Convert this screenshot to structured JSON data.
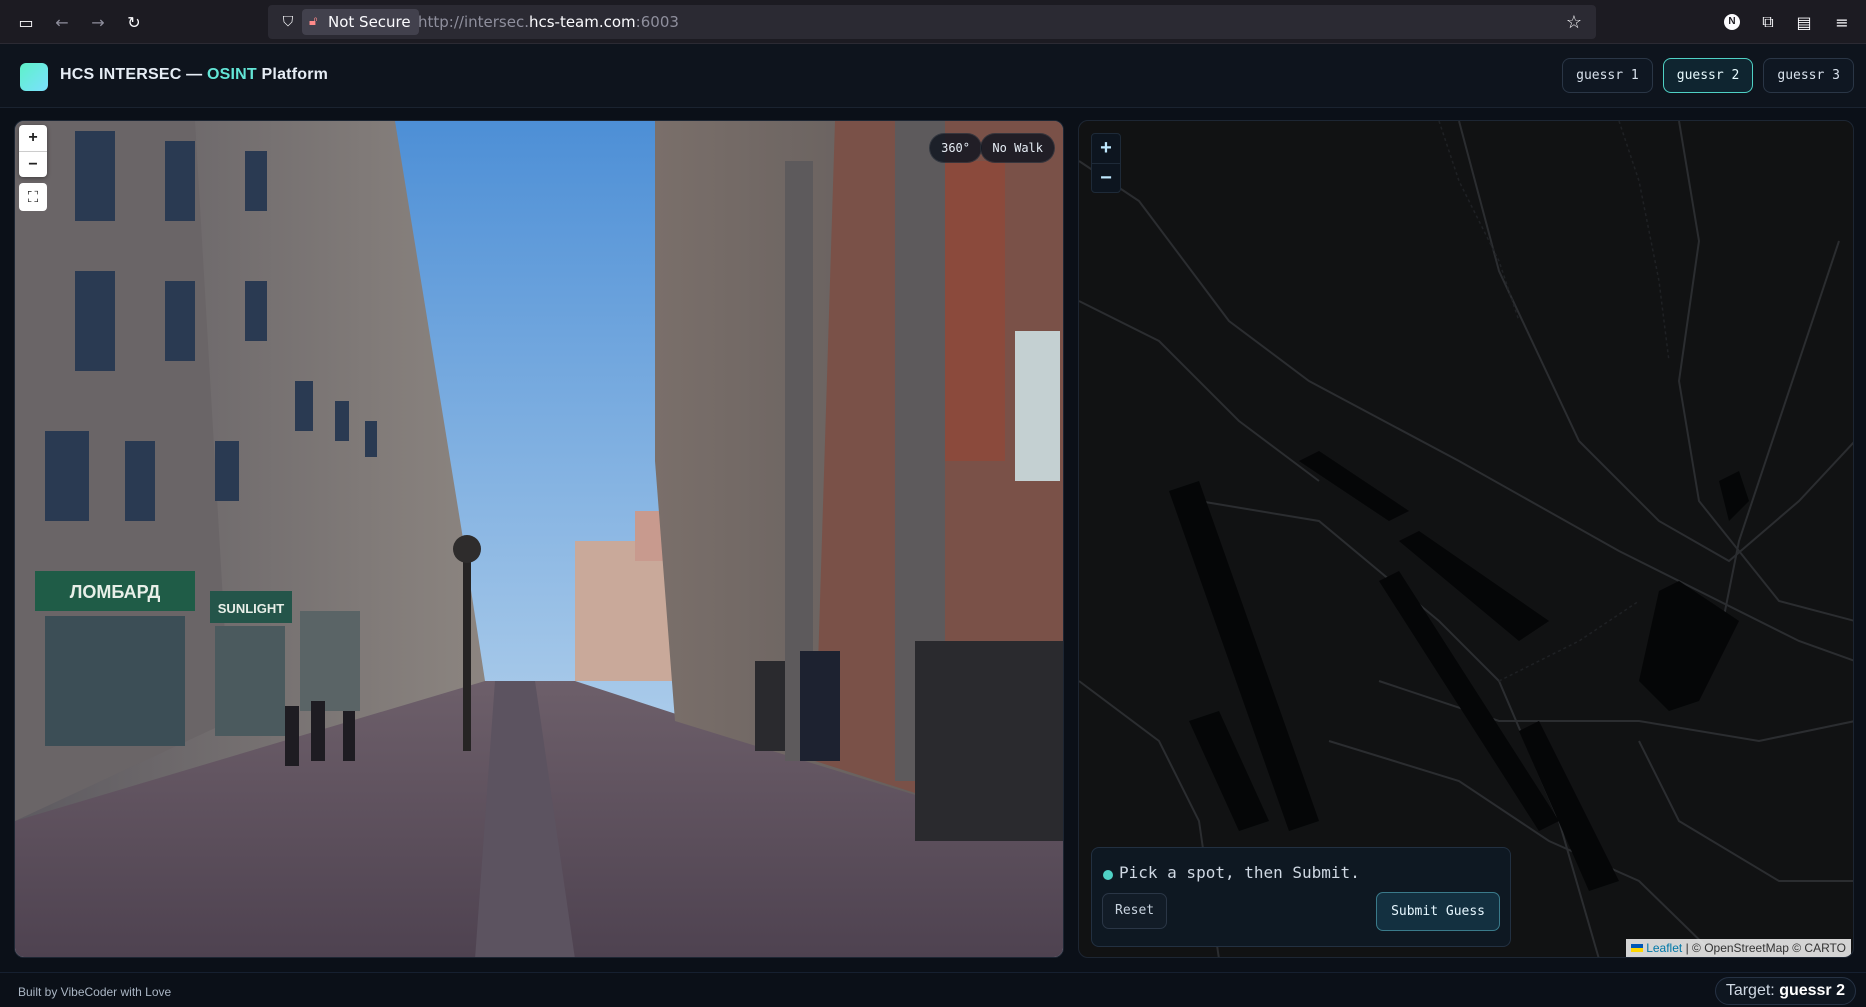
{
  "browser": {
    "not_secure_label": "Not Secure",
    "url_prefix": "http://intersec.",
    "url_host": "hcs-team.com",
    "url_suffix": ":6003",
    "profile_initial": "N"
  },
  "header": {
    "brand_prefix": "HCS INTERSEC — ",
    "brand_accent": "OSINT",
    "brand_suffix": " Platform",
    "tabs": [
      {
        "label": "guessr 1",
        "active": false
      },
      {
        "label": "guessr 2",
        "active": true
      },
      {
        "label": "guessr 3",
        "active": false
      }
    ]
  },
  "streetview": {
    "zoom_in": "+",
    "zoom_out": "−",
    "badge_360": "360°",
    "badge_walk": "No Walk",
    "scene_signs": [
      "ЛОМБАРД",
      "SUNLIGHT"
    ]
  },
  "map": {
    "zoom_in": "+",
    "zoom_out": "−",
    "status_message": "Pick a spot, then Submit.",
    "reset_label": "Reset",
    "submit_label": "Submit Guess",
    "attribution_leaflet": "Leaflet",
    "attribution_rest": " | © OpenStreetMap © CARTO"
  },
  "footer": {
    "built_by": "Built by VibeCoder with Love",
    "target_label": "Target: ",
    "target_value": "guessr 2"
  },
  "colors": {
    "accent": "#63e6d7",
    "active_tab_border": "#4fd1c5",
    "background": "#0b1018"
  }
}
